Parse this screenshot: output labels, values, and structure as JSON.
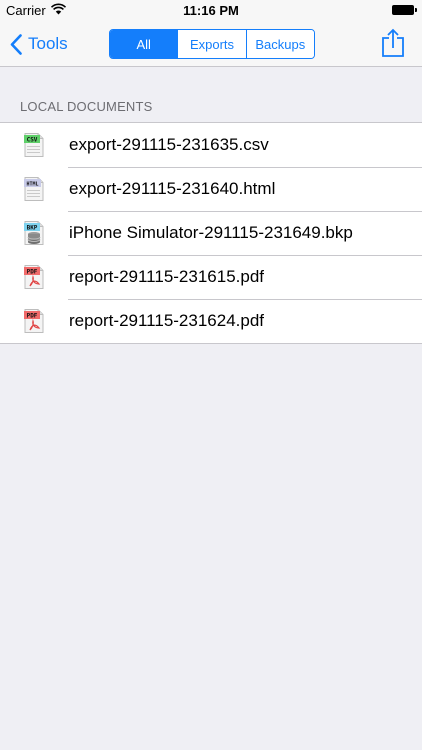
{
  "status_bar": {
    "carrier": "Carrier",
    "time": "11:16 PM"
  },
  "nav": {
    "back_label": "Tools",
    "segments": [
      {
        "label": "All",
        "active": true
      },
      {
        "label": "Exports",
        "active": false
      },
      {
        "label": "Backups",
        "active": false
      }
    ],
    "accent_color": "#147efb"
  },
  "section": {
    "title": "LOCAL DOCUMENTS"
  },
  "documents": [
    {
      "name": "export-291115-231635.csv",
      "icon_label": "CSV",
      "icon": "csv-file-icon"
    },
    {
      "name": "export-291115-231640.html",
      "icon_label": "HTML",
      "icon": "html-file-icon"
    },
    {
      "name": "iPhone Simulator-291115-231649.bkp",
      "icon_label": "BKP",
      "icon": "bkp-file-icon"
    },
    {
      "name": "report-291115-231615.pdf",
      "icon_label": "PDF",
      "icon": "pdf-file-icon"
    },
    {
      "name": "report-291115-231624.pdf",
      "icon_label": "PDF",
      "icon": "pdf-file-icon"
    }
  ]
}
